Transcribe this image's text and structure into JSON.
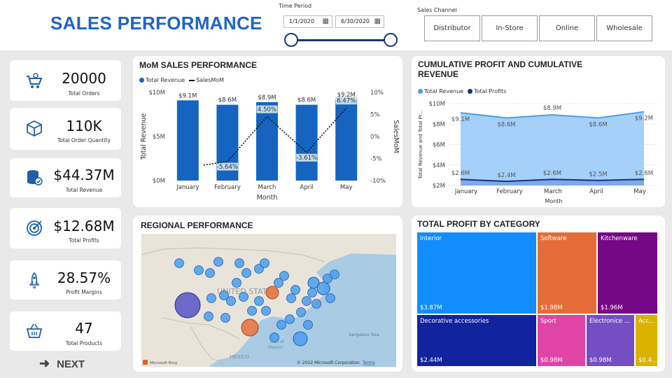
{
  "header": {
    "title": "SALES PERFORMANCE",
    "time_period": {
      "label": "Time Period",
      "start_date": "1/1/2020",
      "end_date": "6/30/2020"
    },
    "sales_channel": {
      "label": "Sales Channel",
      "options": [
        "Distributor",
        "In-Store",
        "Online",
        "Wholesale"
      ]
    }
  },
  "kpis": [
    {
      "value": "20000",
      "label": "Total Orders",
      "icon": "shopping-cart-gear-icon"
    },
    {
      "value": "110K",
      "label": "Total Order Quantity",
      "icon": "box-icon"
    },
    {
      "value": "$44.37M",
      "label": "Total Revenue",
      "icon": "coins-check-icon"
    },
    {
      "value": "$12.68M",
      "label": "Total Profits",
      "icon": "target-icon"
    },
    {
      "value": "28.57%",
      "label": "Profit Margins",
      "icon": "rocket-icon"
    },
    {
      "value": "47",
      "label": "Total Products",
      "icon": "basket-icon"
    }
  ],
  "nav": {
    "next_label": "NEXT"
  },
  "mom_panel": {
    "title": "MoM SALES PERFORMANCE",
    "legend": [
      "Total Revenue",
      "SalesMoM"
    ]
  },
  "cumulative_panel": {
    "title_line1": "CUMULATIVE PROFIT AND CUMULATIVE",
    "title_line2": "REVENUE",
    "legend": [
      "Total Revenue",
      "Total Profits"
    ]
  },
  "regional_panel": {
    "title": "REGIONAL PERFORMANCE",
    "map_labels": {
      "country": "UNITED STATES",
      "mexico": "MEXICO",
      "gulf_line1": "Gulf of",
      "gulf_line2": "Mexico",
      "sea": "Sargasso Sea",
      "provider": "Microsoft Bing",
      "copyright": "© 2022 Microsoft Corporation",
      "terms": "Terms"
    }
  },
  "category_panel": {
    "title": "TOTAL PROFIT BY CATEGORY",
    "tiles": [
      {
        "name": "Interior",
        "value": "$3.87M",
        "color": "#118dff"
      },
      {
        "name": "Software",
        "value": "$1.98M",
        "color": "#e66c37"
      },
      {
        "name": "Kitchenware",
        "value": "$1.96M",
        "color": "#750985"
      },
      {
        "name": "Decorative accessories",
        "value": "$2.44M",
        "color": "#12239e"
      },
      {
        "name": "Sport",
        "value": "$0.98M",
        "color": "#e044a7"
      },
      {
        "name": "Electronice ...",
        "value": "$0.98M",
        "color": "#744ec2"
      },
      {
        "name": "Acc...",
        "value": "$0.4...",
        "color": "#d9b300"
      }
    ]
  },
  "chart_data": [
    {
      "type": "bar",
      "title": "MoM SALES PERFORMANCE",
      "categories": [
        "January",
        "February",
        "March",
        "April",
        "May"
      ],
      "series": [
        {
          "name": "Total Revenue",
          "values": [
            9.1,
            8.6,
            8.9,
            8.6,
            9.2
          ],
          "unit": "$M",
          "axis": "left",
          "color": "#1565c0"
        },
        {
          "name": "SalesMoM",
          "values": [
            null,
            -5.64,
            4.5,
            -3.61,
            6.47
          ],
          "unit": "%",
          "axis": "right",
          "style": "dotted-line",
          "color": "#111111"
        }
      ],
      "data_labels": [
        "$9.1M",
        "$8.6M",
        "$8.9M",
        "$8.6M",
        "$9.2M"
      ],
      "mom_labels": [
        "",
        "-5.64%",
        "4.50%",
        "-3.61%",
        "6.47%"
      ],
      "xlabel": "Month",
      "ylabel": "Total Revenue",
      "y2label": "SalesMoM",
      "ylim": [
        0,
        10
      ],
      "y2lim": [
        -10,
        10
      ],
      "yticks": [
        "$0M",
        "$5M",
        "$10M"
      ],
      "y2ticks": [
        "10%",
        "5%",
        "0%",
        "-5%",
        "-10%"
      ],
      "legend": "top-left"
    },
    {
      "type": "area",
      "title": "CUMULATIVE PROFIT AND CUMULATIVE REVENUE",
      "categories": [
        "January",
        "February",
        "March",
        "April",
        "May"
      ],
      "series": [
        {
          "name": "Total Revenue",
          "values": [
            9.1,
            8.6,
            8.9,
            8.6,
            9.2
          ],
          "color": "#4a9df0"
        },
        {
          "name": "Total Profits",
          "values": [
            2.6,
            2.4,
            2.6,
            2.5,
            2.6
          ],
          "color": "#1a2d8a"
        }
      ],
      "revenue_labels": [
        "$9.1M",
        "$8.6M",
        "$8.9M",
        "$8.6M",
        "$9.2M"
      ],
      "profit_labels": [
        "$2.6M",
        "$2.4M",
        "$2.6M",
        "$2.5M",
        "$2.6M"
      ],
      "xlabel": "Month",
      "ylabel": "Total Revenue and Total Pr...",
      "ylim": [
        2,
        10
      ],
      "yticks": [
        "$2M",
        "$4M",
        "$6M",
        "$8M",
        "$10M"
      ],
      "legend": "top-left",
      "grid": true
    }
  ]
}
